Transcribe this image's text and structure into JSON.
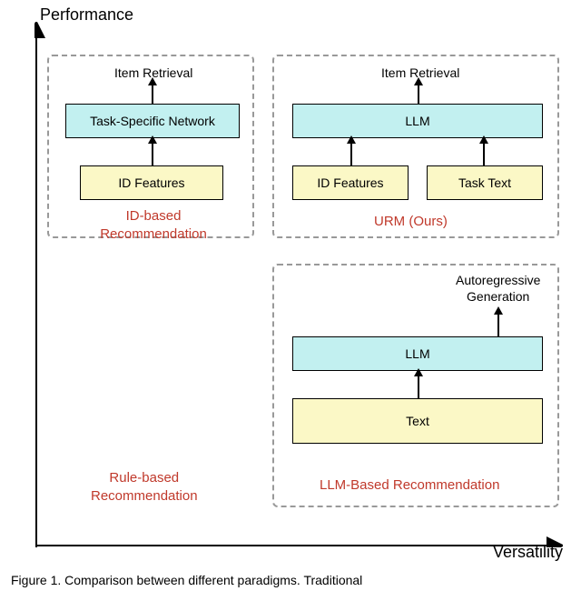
{
  "axes": {
    "y": "Performance",
    "x": "Versatility"
  },
  "panels": {
    "id": {
      "output": "Item Retrieval",
      "network": "Task-Specific Network",
      "input": "ID Features",
      "label": "ID-based\nRecommendation"
    },
    "urm": {
      "output": "Item Retrieval",
      "network": "LLM",
      "input1": "ID Features",
      "input2": "Task Text",
      "label": "URM (Ours)"
    },
    "llm": {
      "output": "Autoregressive\nGeneration",
      "network": "LLM",
      "input": "Text",
      "label": "LLM-Based Recommendation"
    },
    "rule": {
      "label": "Rule-based\nRecommendation"
    }
  },
  "caption": "Figure 1. Comparison between different paradigms. Traditional"
}
